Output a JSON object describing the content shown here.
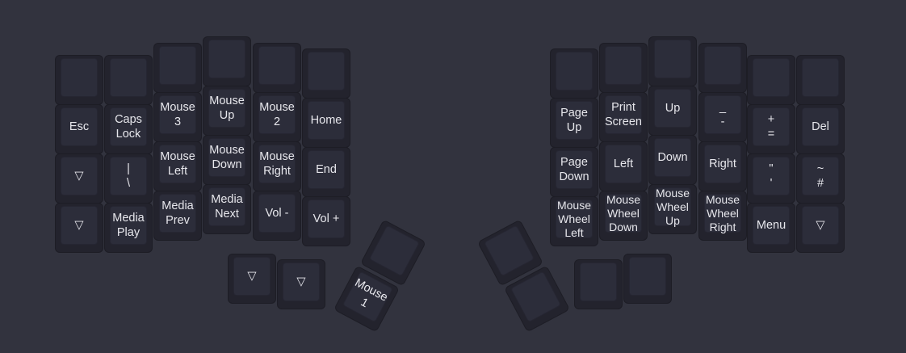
{
  "colors": {
    "background": "#32333e",
    "key": "#23232d",
    "keycap": "#2c2d3a",
    "text": "#e7e7ec"
  },
  "left_hand": {
    "rows": [
      [
        "",
        "",
        "",
        "",
        "",
        ""
      ],
      [
        "Esc",
        "Caps\nLock",
        "Mouse\n3",
        "Mouse\nUp",
        "Mouse\n2",
        "Home"
      ],
      [
        "▽",
        "|\n\\",
        "Mouse\nLeft",
        "Mouse\nDown",
        "Mouse\nRight",
        "End"
      ],
      [
        "▽",
        "Media\nPlay",
        "Media\nPrev",
        "Media\nNext",
        "Vol -",
        "Vol +"
      ]
    ],
    "thumb": [
      "▽",
      "▽",
      "",
      "Mouse\n1"
    ]
  },
  "right_hand": {
    "rows": [
      [
        "",
        "",
        "",
        "",
        "",
        ""
      ],
      [
        "Page\nUp",
        "Print\nScreen",
        "Up",
        "_\n-",
        "+\n=",
        "Del"
      ],
      [
        "Page\nDown",
        "Left",
        "Down",
        "Right",
        "\"\n'",
        "~\n#"
      ],
      [
        "Mouse\nWheel\nLeft",
        "Mouse\nWheel\nDown",
        "Mouse\nWheel\nUp",
        "Mouse\nWheel\nRight",
        "Menu",
        "▽"
      ]
    ],
    "thumb": [
      "",
      "",
      "",
      ""
    ]
  }
}
